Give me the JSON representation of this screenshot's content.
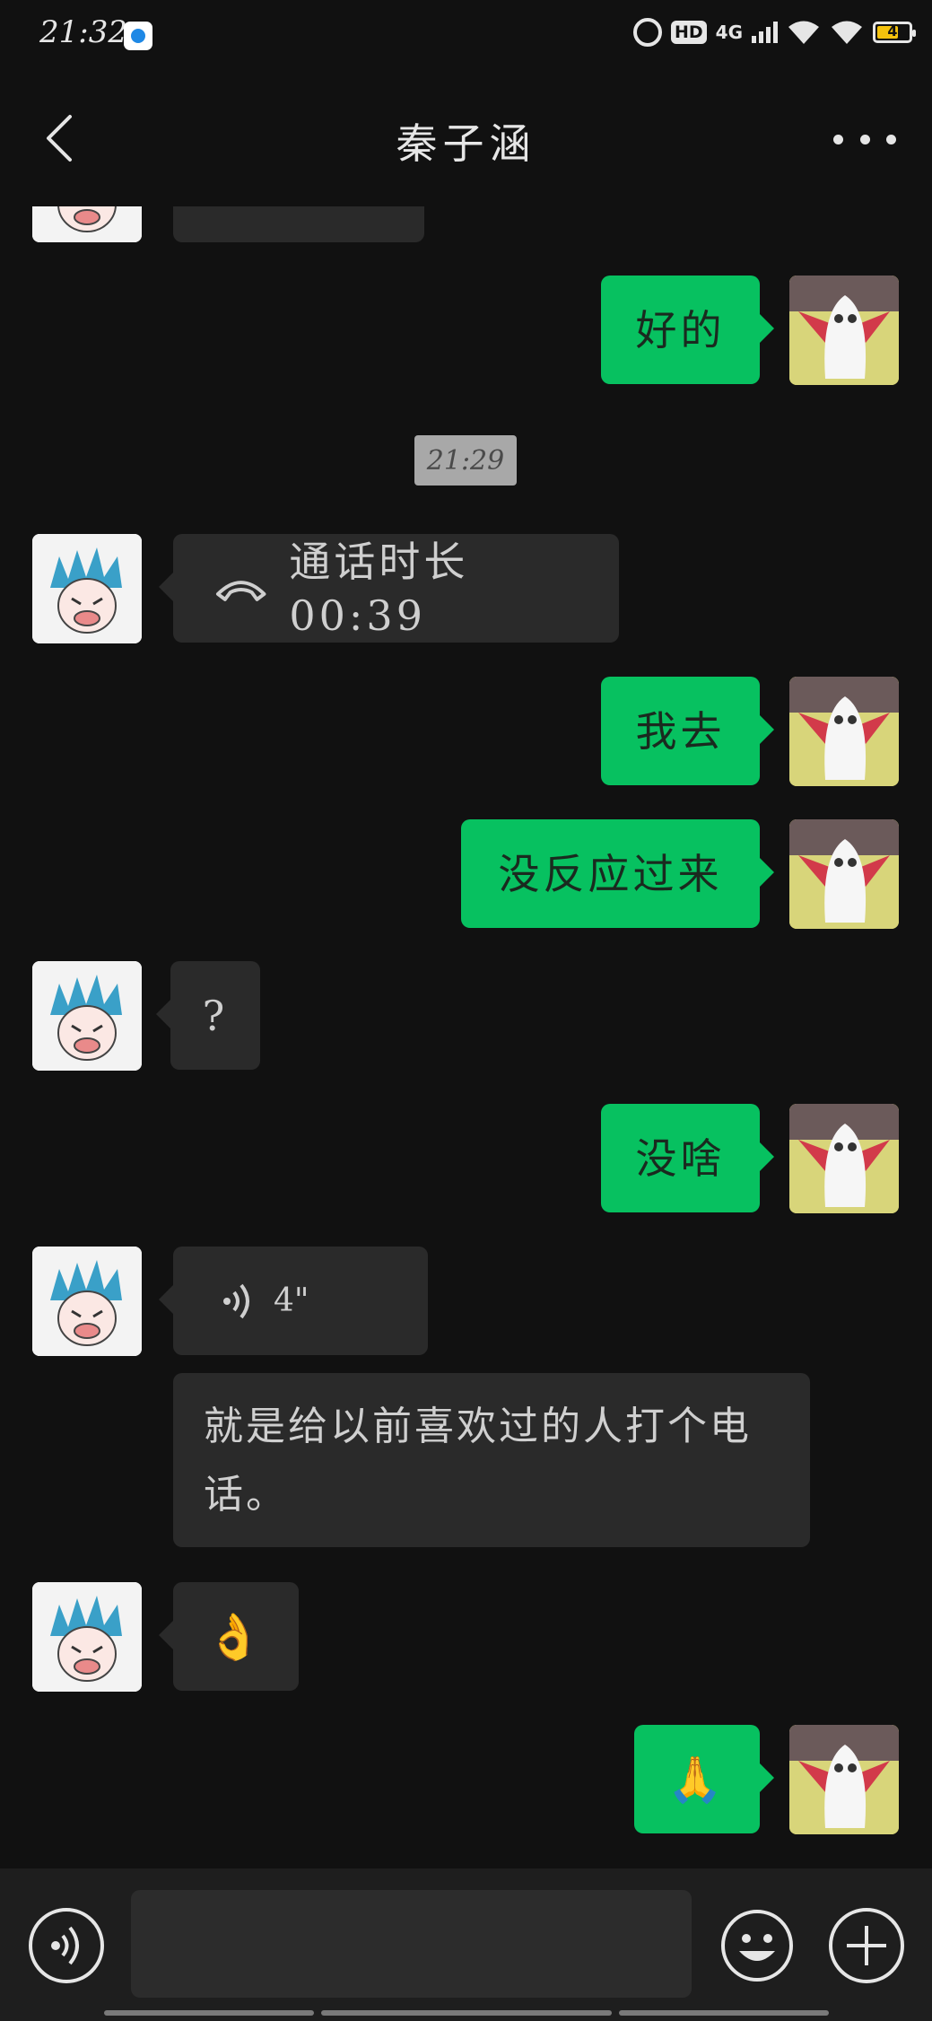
{
  "status_bar": {
    "time": "21:32",
    "network": "4G",
    "hd": "HD",
    "battery": "4",
    "colors": {
      "battery_fill": "#f4c20d"
    }
  },
  "header": {
    "title": "秦子涵",
    "back_icon": "chevron-left-icon",
    "more_icon": "more-dots-icon"
  },
  "messages": {
    "m1_text": "好的",
    "timestamp": "21:29",
    "call_label": "通话时长 00:39",
    "m3_text": "我去",
    "m4_text": "没反应过来",
    "m5_text": "?",
    "m6_text": "没啥",
    "voice_duration": "4\"",
    "voice_transcript": "就是给以前喜欢过的人打个电话。",
    "ok_emoji": "👌",
    "pray_emoji": "🙏"
  },
  "input_bar": {
    "placeholder": "",
    "voice_icon": "voice-icon",
    "emoji_icon": "emoji-icon",
    "plus_icon": "plus-icon"
  },
  "colors": {
    "background": "#111111",
    "outgoing_bubble": "#07c160",
    "incoming_bubble": "#2a2a2a"
  }
}
